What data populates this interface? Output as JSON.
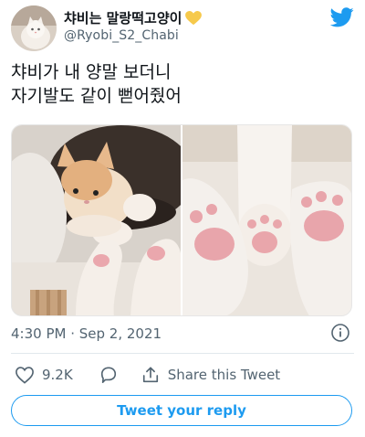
{
  "author": {
    "display_name": "챠비는 말랑떡고양이",
    "handle": "@Ryobi_S2_Chabi",
    "badge_icon": "yellow-heart-icon",
    "avatar_icon": "cat-avatar-icon"
  },
  "brand": {
    "logo_icon": "twitter-bird-icon",
    "accent_color": "#1d9bf0"
  },
  "tweet": {
    "text_lines": [
      "챠비가 내 양말 보더니",
      "자기발도 같이 뻗어줬어"
    ],
    "media": [
      {
        "description_icon": "cat-photo"
      },
      {
        "description_icon": "paws-photo"
      }
    ],
    "timestamp": "4:30 PM · Sep 2, 2021"
  },
  "actions": {
    "like_count": "9.2K",
    "share_label": "Share this Tweet"
  },
  "reply": {
    "button_label": "Tweet your reply"
  }
}
